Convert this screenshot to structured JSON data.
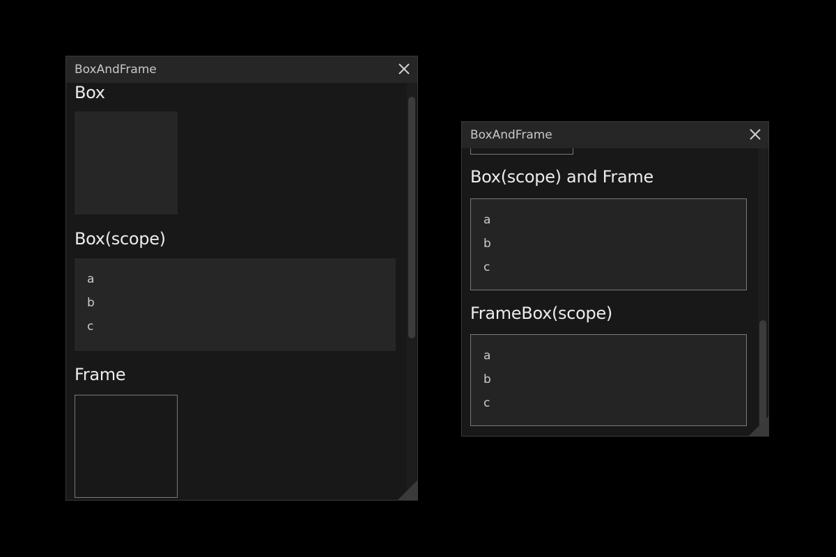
{
  "windows": [
    {
      "title": "BoxAndFrame",
      "sections": {
        "box": {
          "heading": "Box"
        },
        "box_scope": {
          "heading": "Box(scope)",
          "items": [
            "a",
            "b",
            "c"
          ]
        },
        "frame": {
          "heading": "Frame"
        }
      }
    },
    {
      "title": "BoxAndFrame",
      "sections": {
        "box_scope_and_frame": {
          "heading": "Box(scope) and Frame",
          "items": [
            "a",
            "b",
            "c"
          ]
        },
        "framebox_scope": {
          "heading": "FrameBox(scope)",
          "items": [
            "a",
            "b",
            "c"
          ]
        }
      }
    }
  ],
  "icons": {
    "close": "close-icon",
    "resize": "resize-grip-icon"
  },
  "colors": {
    "desktop": "#000000",
    "window_bg": "#181818",
    "titlebar_bg": "#262626",
    "box_bg": "#262626",
    "frame_border": "#7a7a7a",
    "heading_text": "#ececec"
  }
}
